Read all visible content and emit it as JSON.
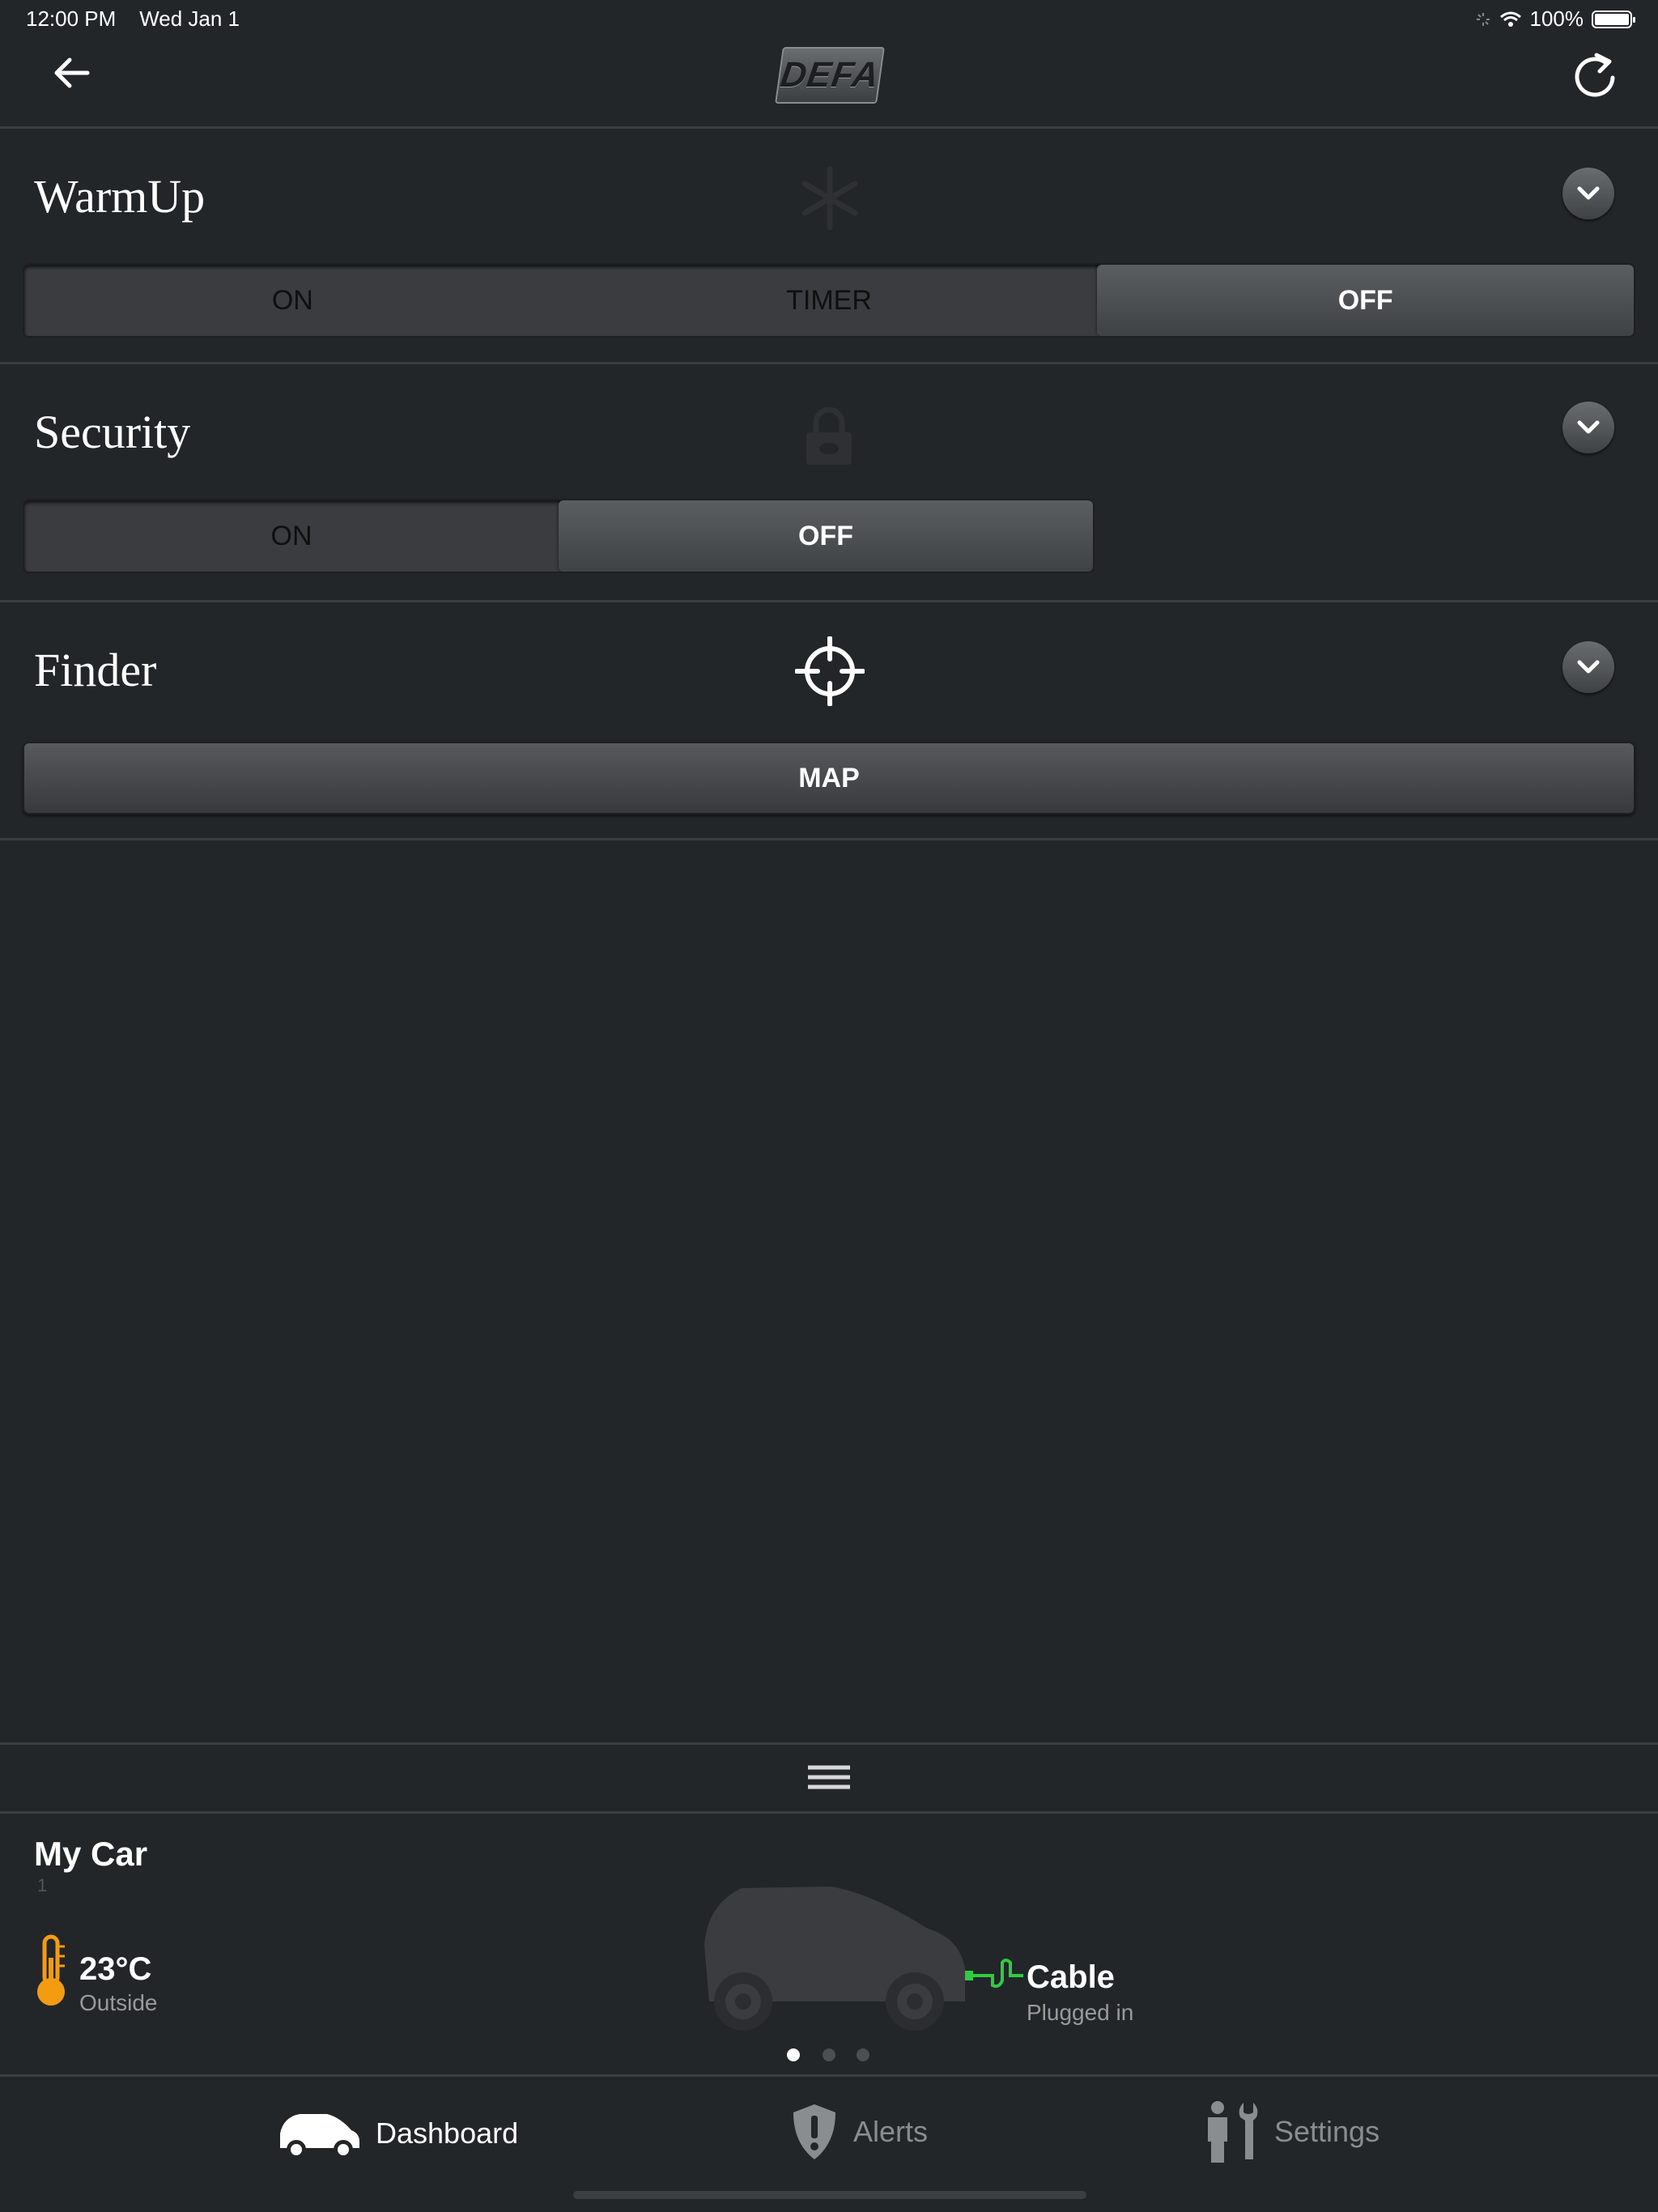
{
  "status_bar": {
    "time": "12:00 PM",
    "date": "Wed Jan 1",
    "battery": "100%"
  },
  "header": {
    "logo_text": "DEFA",
    "back_icon": "back-arrow-icon",
    "refresh_icon": "refresh-icon"
  },
  "warmup": {
    "title": "WarmUp",
    "icon": "snowflake-icon",
    "options": [
      "ON",
      "TIMER",
      "OFF"
    ],
    "selected": "OFF"
  },
  "security": {
    "title": "Security",
    "icon": "lock-icon",
    "options": [
      "ON",
      "OFF"
    ],
    "selected": "OFF"
  },
  "finder": {
    "title": "Finder",
    "icon": "crosshair-icon",
    "map_label": "MAP"
  },
  "car": {
    "name": "My Car",
    "sub": "1",
    "temperature": "23°C",
    "temperature_label": "Outside",
    "cable": "Cable",
    "cable_status": "Plugged in",
    "page_count": 3,
    "active_page": 1
  },
  "tabs": [
    {
      "label": "Dashboard",
      "icon": "car-icon",
      "active": true
    },
    {
      "label": "Alerts",
      "icon": "shield-alert-icon",
      "active": false
    },
    {
      "label": "Settings",
      "icon": "person-wrench-icon",
      "active": false
    }
  ],
  "colors": {
    "background": "#232629",
    "accent_orange": "#f39c12",
    "cable_green": "#2ecc40"
  }
}
